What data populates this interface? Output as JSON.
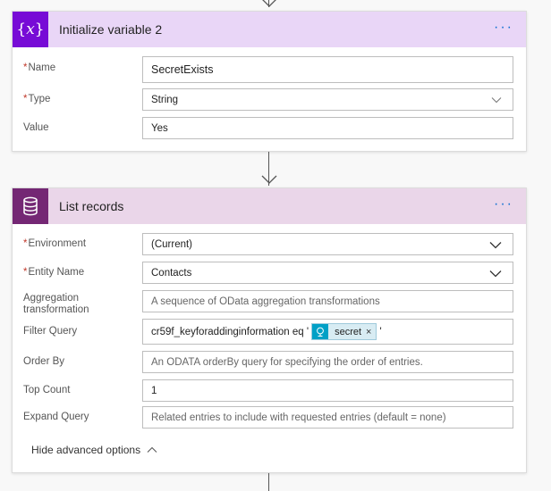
{
  "card1": {
    "title": "Initialize variable 2",
    "menu": "···",
    "icon": "curly-x-icon",
    "fields": {
      "name": {
        "label": "Name",
        "required": "*",
        "value": "SecretExists"
      },
      "type": {
        "label": "Type",
        "required": "*",
        "value": "String"
      },
      "value": {
        "label": "Value",
        "value": "Yes"
      }
    }
  },
  "card2": {
    "title": "List records",
    "menu": "···",
    "icon": "database-icon",
    "fields": {
      "environment": {
        "label": "Environment",
        "required": "*",
        "value": "(Current)"
      },
      "entity": {
        "label": "Entity Name",
        "required": "*",
        "value": "Contacts"
      },
      "aggregation": {
        "label_line1": "Aggregation",
        "label_line2": "transformation",
        "placeholder": "A sequence of OData aggregation transformations"
      },
      "filter": {
        "label": "Filter Query",
        "prefix": "cr59f_keyforaddinginformation eq '",
        "token_label": "secret",
        "token_close": "×",
        "suffix": "'"
      },
      "orderby": {
        "label": "Order By",
        "placeholder": "An ODATA orderBy query for specifying the order of entries."
      },
      "top": {
        "label": "Top Count",
        "value": "1"
      },
      "expand": {
        "label": "Expand Query",
        "placeholder": "Related entries to include with requested entries (default = none)"
      }
    },
    "advanced_toggle": "Hide advanced options"
  },
  "colors": {
    "variable_accent": "#770bd6",
    "variable_header": "#e9d6f7",
    "dataverse_accent": "#742774",
    "dataverse_header": "#ead6e9",
    "token_accent": "#00a0c6",
    "link_blue": "#0a6ed1"
  }
}
